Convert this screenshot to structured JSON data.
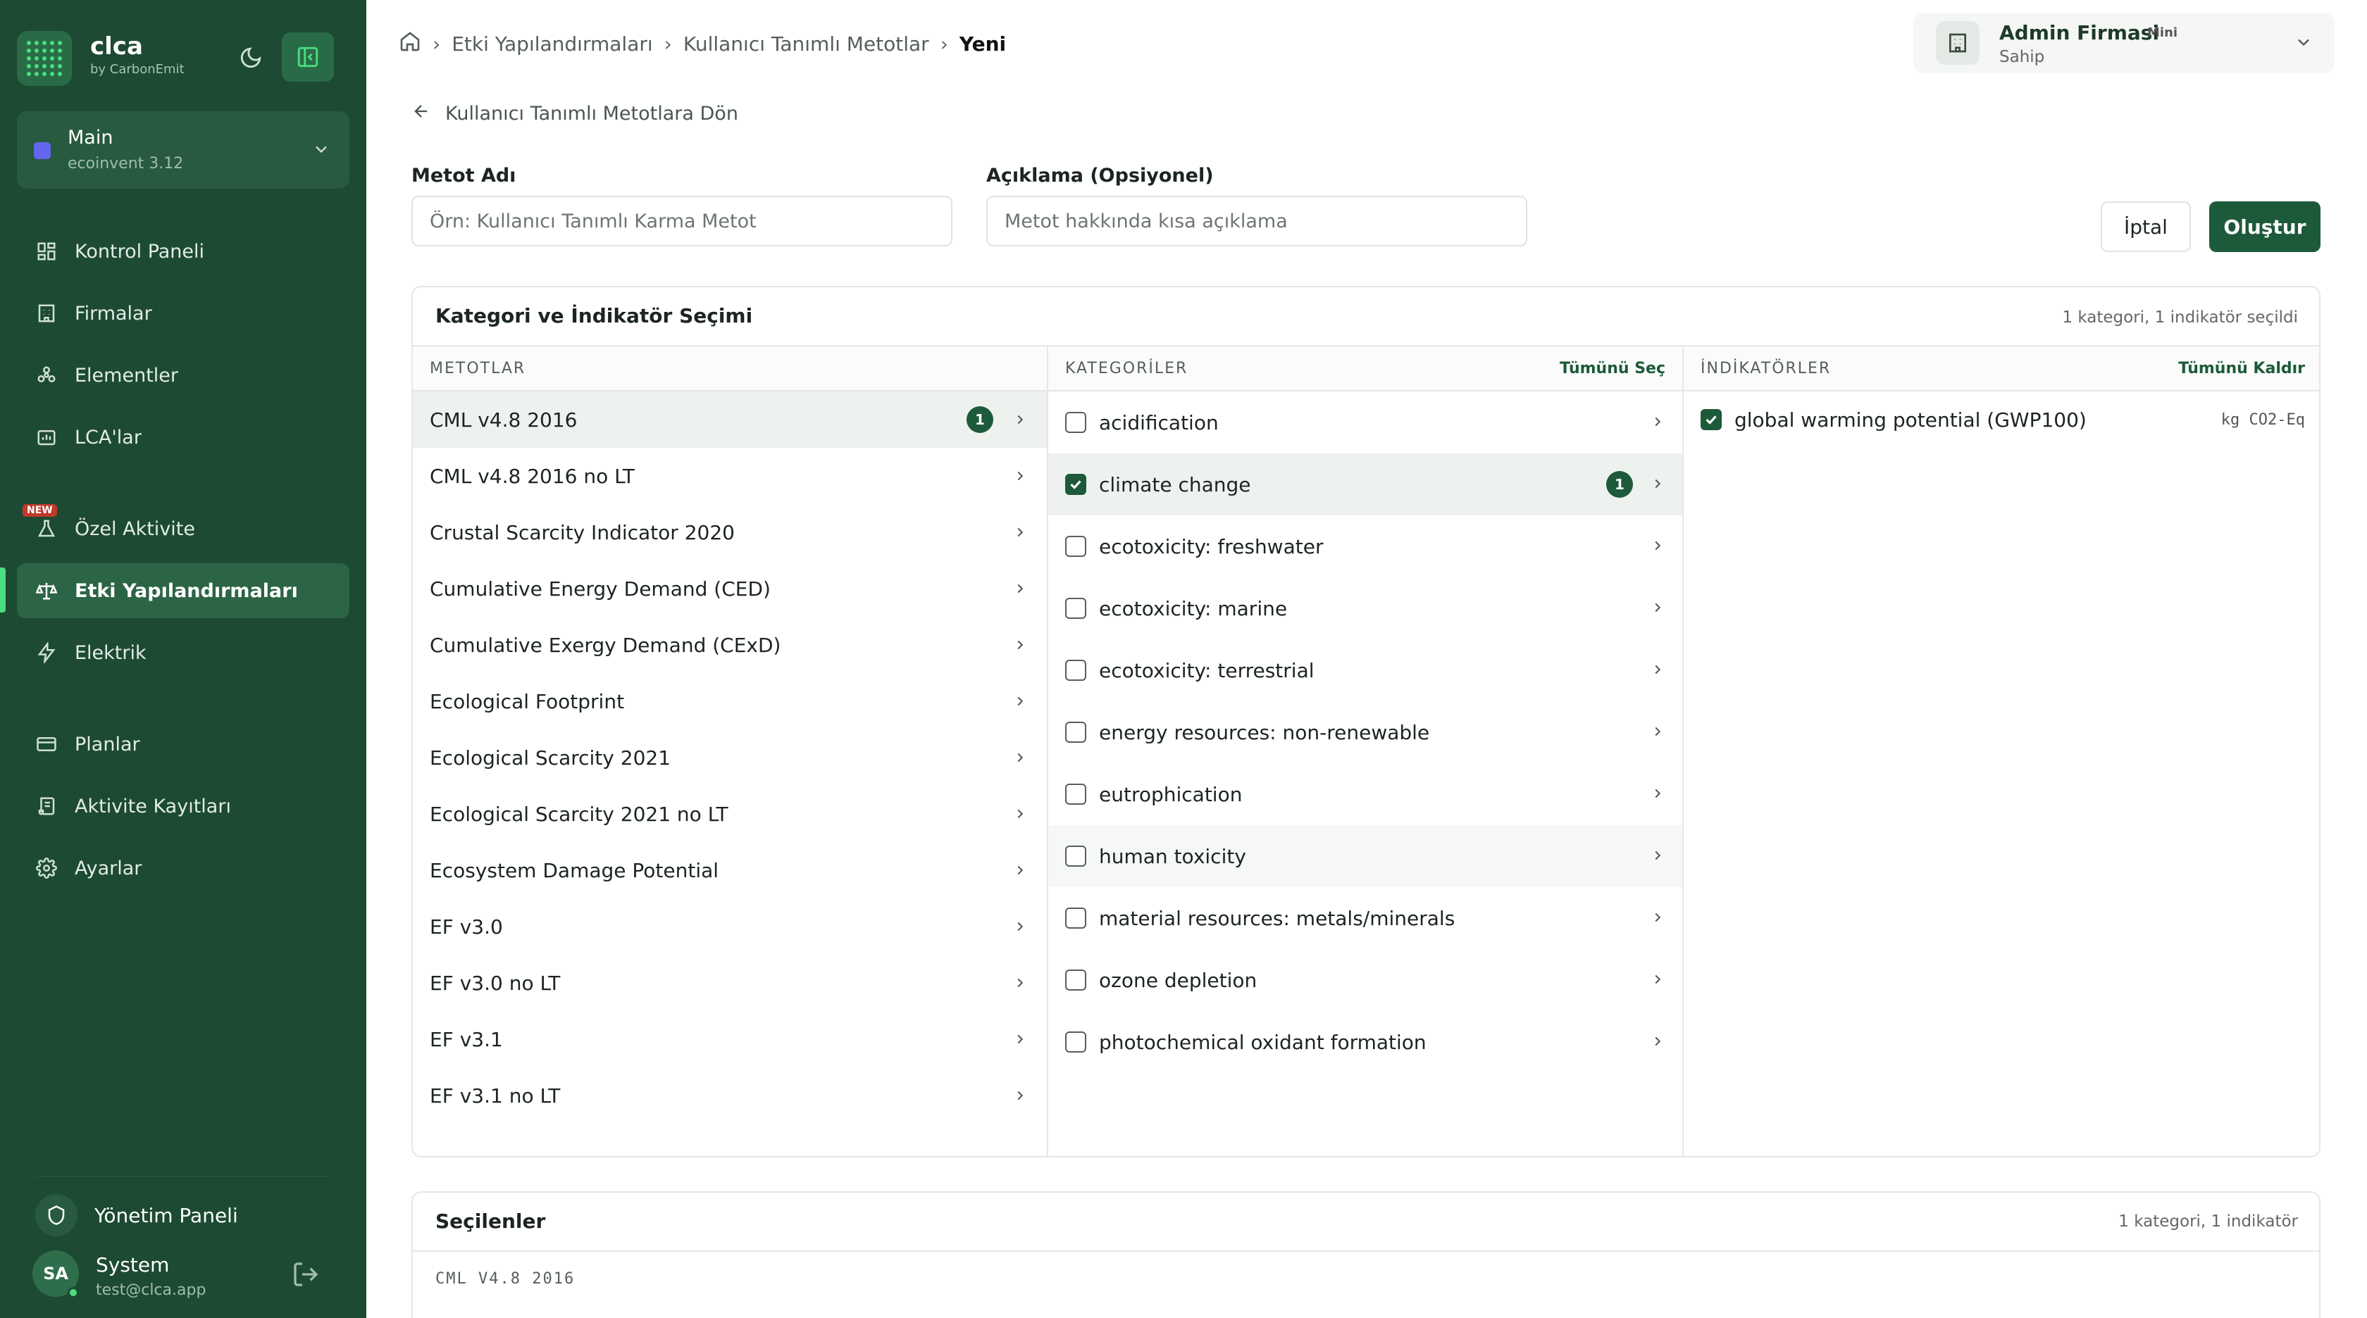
{
  "brand": {
    "name": "clca",
    "sub": "by CarbonEmit"
  },
  "project": {
    "name": "Main",
    "sub": "ecoinvent 3.12"
  },
  "nav": {
    "dashboard": "Kontrol Paneli",
    "firms": "Firmalar",
    "elements": "Elementler",
    "lcas": "LCA'lar",
    "custom_activity": "Özel Aktivite",
    "new_badge": "NEW",
    "impact_configs": "Etki Yapılandırmaları",
    "electricity": "Elektrik",
    "plans": "Planlar",
    "activity_records": "Aktivite Kayıtları",
    "settings": "Ayarlar"
  },
  "admin_panel": "Yönetim Paneli",
  "user": {
    "initials": "SA",
    "name": "System",
    "email": "test@clca.app"
  },
  "breadcrumb": {
    "level1": "Etki Yapılandırmaları",
    "level2": "Kullanıcı Tanımlı Metotlar",
    "current": "Yeni"
  },
  "firm": {
    "name": "Admin Firmasi",
    "plan": "Mini",
    "role": "Sahip"
  },
  "back_link": "Kullanıcı Tanımlı Metotlara Dön",
  "form": {
    "name_label": "Metot Adı",
    "name_placeholder": "Örn: Kullanıcı Tanımlı Karma Metot",
    "desc_label": "Açıklama (Opsiyonel)",
    "desc_placeholder": "Metot hakkında kısa açıklama",
    "cancel": "İptal",
    "create": "Oluştur"
  },
  "selection": {
    "title": "Kategori ve İndikatör Seçimi",
    "summary": "1 kategori, 1 indikatör seçildi",
    "methods_header": "METOTLAR",
    "categories_header": "KATEGORİLER",
    "select_all": "Tümünü Seç",
    "indicators_header": "İNDİKATÖRLER",
    "remove_all": "Tümünü Kaldır",
    "methods": [
      {
        "label": "CML v4.8 2016",
        "count": "1"
      },
      {
        "label": "CML v4.8 2016 no LT"
      },
      {
        "label": "Crustal Scarcity Indicator 2020"
      },
      {
        "label": "Cumulative Energy Demand (CED)"
      },
      {
        "label": "Cumulative Exergy Demand (CExD)"
      },
      {
        "label": "Ecological Footprint"
      },
      {
        "label": "Ecological Scarcity 2021"
      },
      {
        "label": "Ecological Scarcity 2021 no LT"
      },
      {
        "label": "Ecosystem Damage Potential"
      },
      {
        "label": "EF v3.0"
      },
      {
        "label": "EF v3.0 no LT"
      },
      {
        "label": "EF v3.1"
      },
      {
        "label": "EF v3.1 no LT"
      }
    ],
    "categories": [
      {
        "label": "acidification"
      },
      {
        "label": "climate change",
        "count": "1"
      },
      {
        "label": "ecotoxicity: freshwater"
      },
      {
        "label": "ecotoxicity: marine"
      },
      {
        "label": "ecotoxicity: terrestrial"
      },
      {
        "label": "energy resources: non-renewable"
      },
      {
        "label": "eutrophication"
      },
      {
        "label": "human toxicity"
      },
      {
        "label": "material resources: metals/minerals"
      },
      {
        "label": "ozone depletion"
      },
      {
        "label": "photochemical oxidant formation"
      }
    ],
    "indicators": [
      {
        "label": "global warming potential (GWP100)",
        "unit": "kg CO2-Eq"
      }
    ]
  },
  "selected": {
    "title": "Seçilenler",
    "summary": "1 kategori, 1 indikatör",
    "group": "CML V4.8 2016"
  },
  "colors": {
    "sidebar": "#1d4a32",
    "accent": "#1d5a3a",
    "highlight": "#4ade80"
  }
}
